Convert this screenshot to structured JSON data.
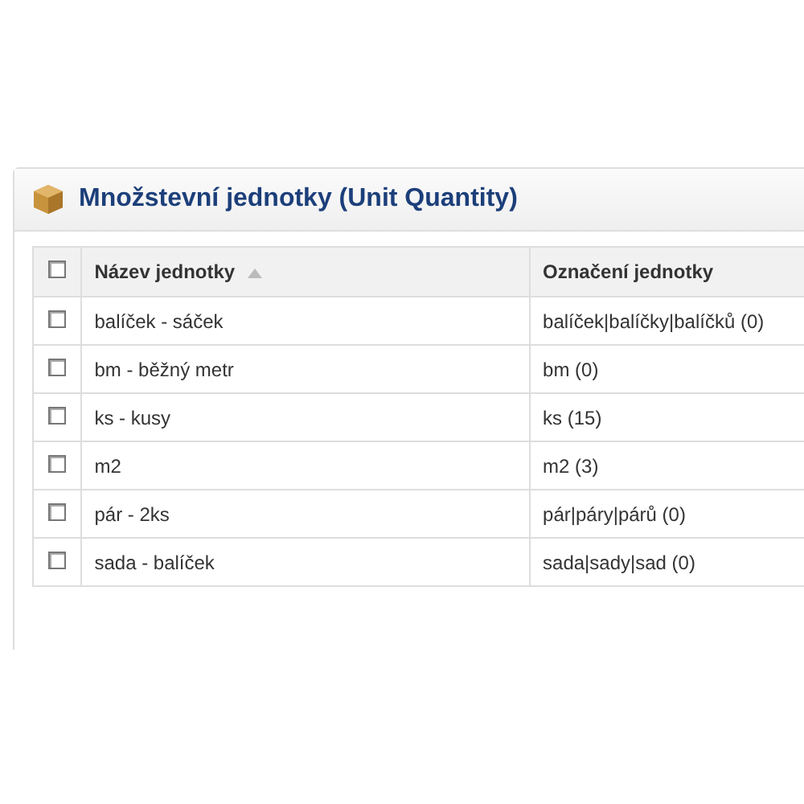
{
  "panel": {
    "title": "Množstevní jednotky (Unit Quantity)"
  },
  "table": {
    "select_all": {
      "checked": false
    },
    "columns": [
      {
        "label": "Název jednotky",
        "sorted": true
      },
      {
        "label": "Označení jednotky",
        "sorted": false
      }
    ],
    "rows": [
      {
        "checked": false,
        "name": "balíček - sáček",
        "code": "balíček|balíčky|balíčků (0)"
      },
      {
        "checked": false,
        "name": "bm - běžný metr",
        "code": "bm (0)"
      },
      {
        "checked": false,
        "name": "ks - kusy",
        "code": "ks (15)"
      },
      {
        "checked": false,
        "name": "m2",
        "code": "m2 (3)"
      },
      {
        "checked": false,
        "name": "pár - 2ks",
        "code": "pár|páry|párů (0)"
      },
      {
        "checked": false,
        "name": "sada - balíček",
        "code": "sada|sady|sad (0)"
      }
    ]
  }
}
